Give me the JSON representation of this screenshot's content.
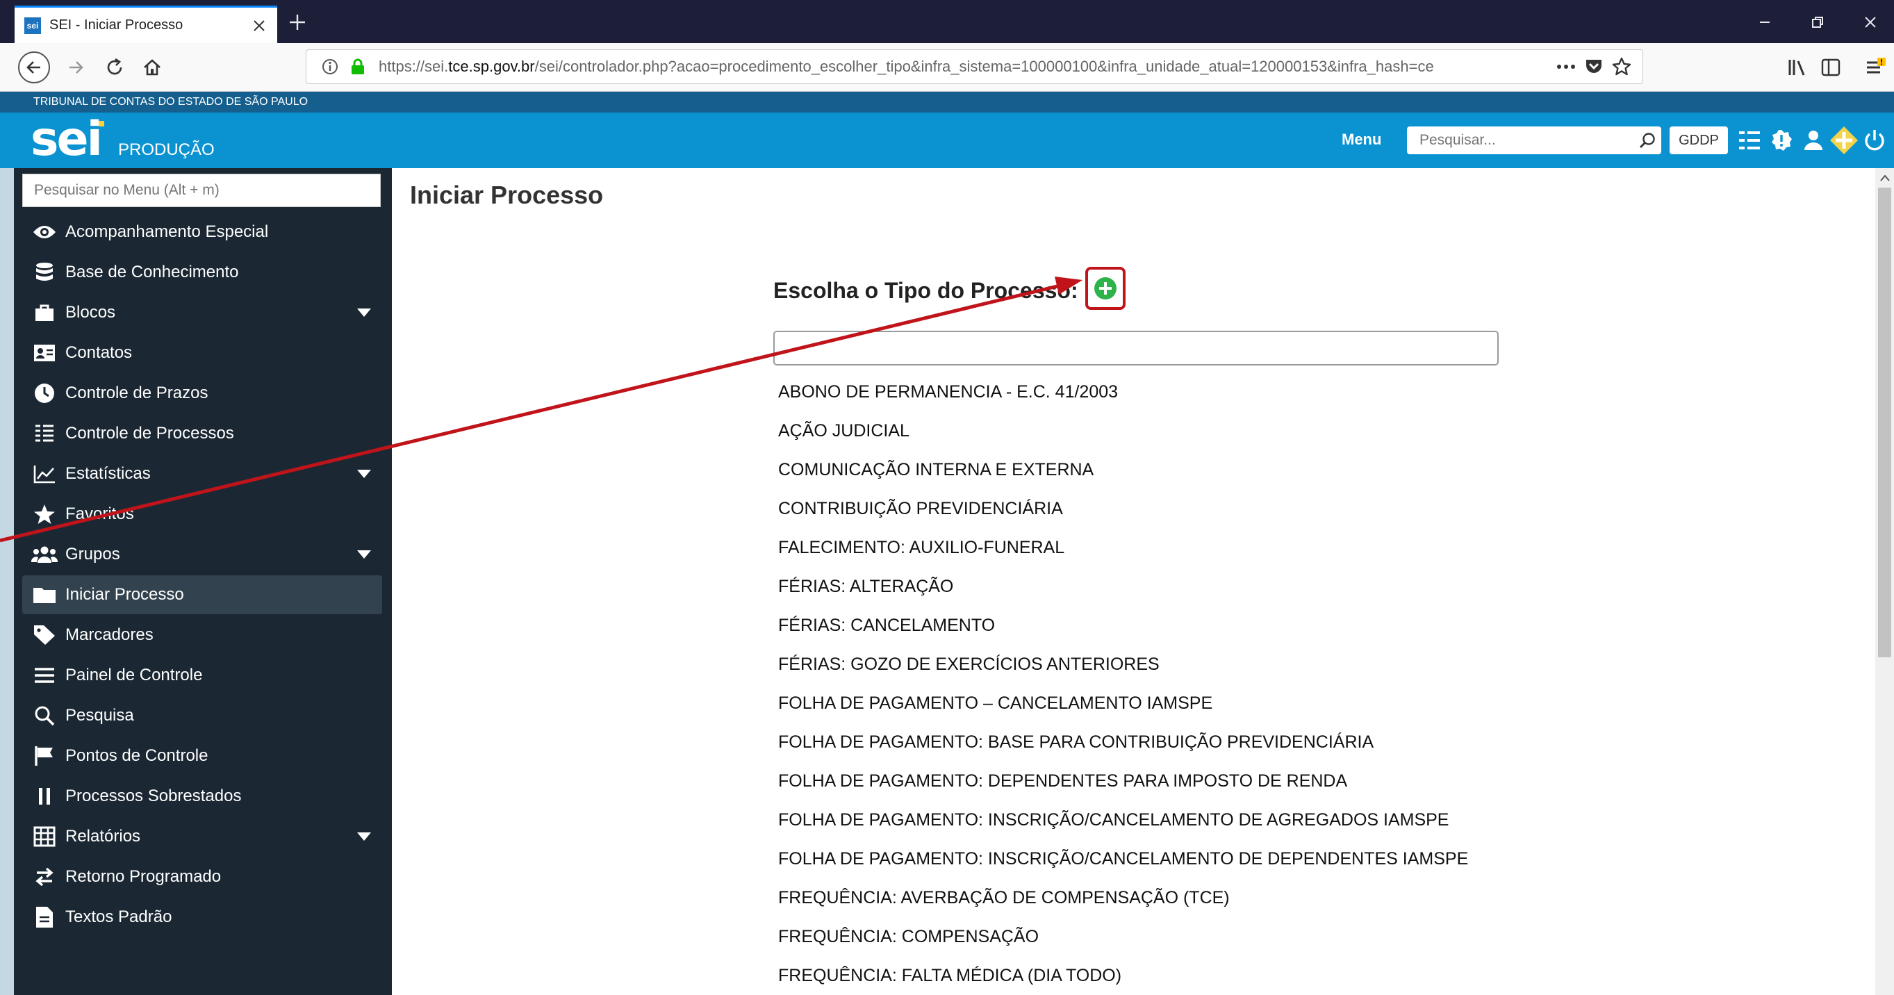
{
  "browser": {
    "tab_title": "SEI - Iniciar Processo",
    "favicon_text": "sei",
    "url_prefix": "https://sei.",
    "url_host": "tce.sp.gov.br",
    "url_rest": "/sei/controlador.php?acao=procedimento_escolher_tipo&infra_sistema=100000100&infra_unidade_atual=120000153&infra_hash=ce"
  },
  "header": {
    "org_name": "TRIBUNAL DE CONTAS DO ESTADO DE SÃO PAULO",
    "logo": "sei",
    "environment": "PRODUÇÃO",
    "menu_label": "Menu",
    "search_placeholder": "Pesquisar...",
    "unit": "GDDP"
  },
  "sidebar": {
    "search_placeholder": "Pesquisar no Menu (Alt + m)",
    "items": [
      {
        "label": "Acompanhamento Especial",
        "icon": "eye-icon"
      },
      {
        "label": "Base de Conhecimento",
        "icon": "database-icon"
      },
      {
        "label": "Blocos",
        "icon": "briefcase-icon",
        "expandable": true
      },
      {
        "label": "Contatos",
        "icon": "contact-card-icon"
      },
      {
        "label": "Controle de Prazos",
        "icon": "clock-icon"
      },
      {
        "label": "Controle de Processos",
        "icon": "list-icon"
      },
      {
        "label": "Estatísticas",
        "icon": "line-chart-icon",
        "expandable": true
      },
      {
        "label": "Favoritos",
        "icon": "star-icon"
      },
      {
        "label": "Grupos",
        "icon": "users-icon",
        "expandable": true
      },
      {
        "label": "Iniciar Processo",
        "icon": "folder-icon",
        "active": true
      },
      {
        "label": "Marcadores",
        "icon": "tag-icon"
      },
      {
        "label": "Painel de Controle",
        "icon": "bars-icon"
      },
      {
        "label": "Pesquisa",
        "icon": "search-icon"
      },
      {
        "label": "Pontos de Controle",
        "icon": "flag-icon"
      },
      {
        "label": "Processos Sobrestados",
        "icon": "pause-icon"
      },
      {
        "label": "Relatórios",
        "icon": "table-icon",
        "expandable": true
      },
      {
        "label": "Retorno Programado",
        "icon": "exchange-icon"
      },
      {
        "label": "Textos Padrão",
        "icon": "document-icon"
      }
    ]
  },
  "main": {
    "title": "Iniciar Processo",
    "choose_label": "Escolha o Tipo do Processo:",
    "filter_value": "",
    "process_types": [
      "ABONO DE PERMANENCIA - E.C. 41/2003",
      "AÇÃO JUDICIAL",
      "COMUNICAÇÃO INTERNA E EXTERNA",
      "CONTRIBUIÇÃO PREVIDENCIÁRIA",
      "FALECIMENTO: AUXILIO-FUNERAL",
      "FÉRIAS: ALTERAÇÃO",
      "FÉRIAS: CANCELAMENTO",
      "FÉRIAS: GOZO DE EXERCÍCIOS ANTERIORES",
      "FOLHA DE PAGAMENTO – CANCELAMENTO IAMSPE",
      "FOLHA DE PAGAMENTO: BASE PARA CONTRIBUIÇÃO PREVIDENCIÁRIA",
      "FOLHA DE PAGAMENTO: DEPENDENTES PARA IMPOSTO DE RENDA",
      "FOLHA DE PAGAMENTO: INSCRIÇÃO/CANCELAMENTO DE AGREGADOS IAMSPE",
      "FOLHA DE PAGAMENTO: INSCRIÇÃO/CANCELAMENTO DE DEPENDENTES IAMSPE",
      "FREQUÊNCIA: AVERBAÇÃO DE COMPENSAÇÃO (TCE)",
      "FREQUÊNCIA: COMPENSAÇÃO",
      "FREQUÊNCIA: FALTA MÉDICA (DIA TODO)"
    ]
  },
  "colors": {
    "tabstrip": "#1d1f39",
    "header_blue": "#0b93d1",
    "org_bar": "#155f8f",
    "sidebar_bg": "#1b2833",
    "sidebar_active": "#32424e",
    "add_button_green": "#2db34a",
    "annotation_red": "#c0141a"
  }
}
